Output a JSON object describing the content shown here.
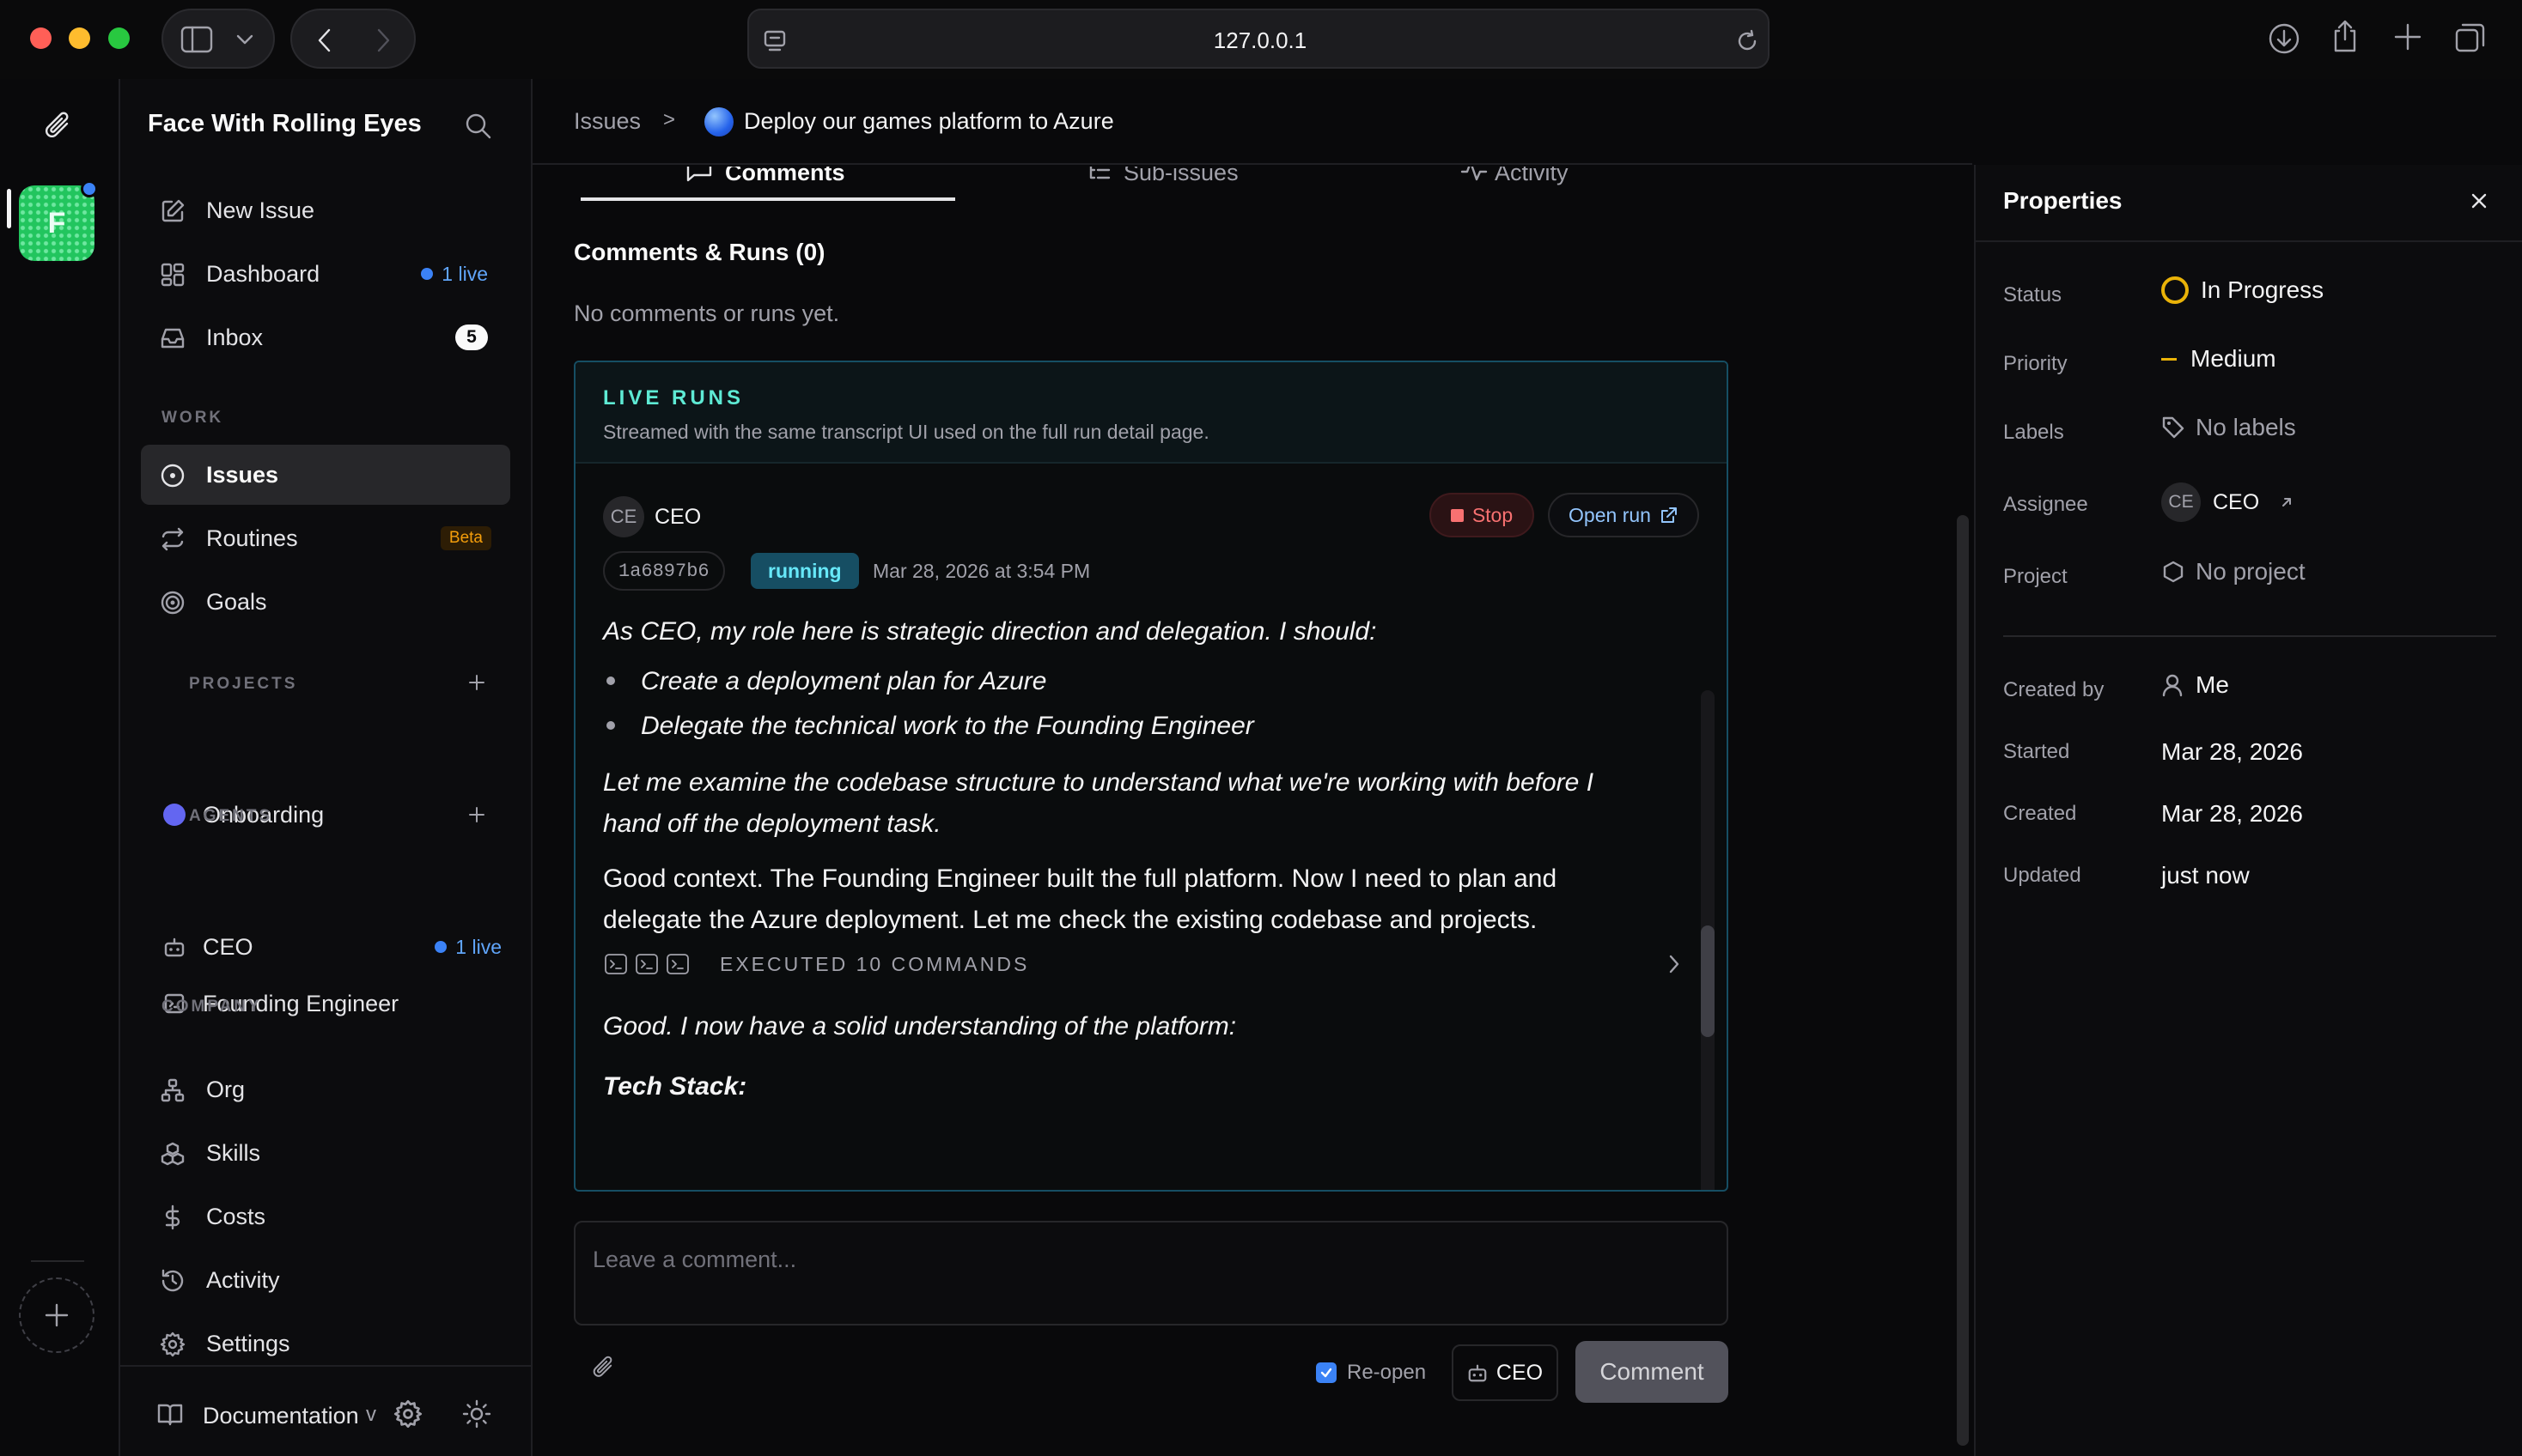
{
  "browser": {
    "url": "127.0.0.1"
  },
  "workspace": {
    "name": "Face With Rolling Eyes",
    "avatar_letter": "F"
  },
  "nav": {
    "new_issue": "New Issue",
    "dashboard": "Dashboard",
    "dashboard_badge": "1 live",
    "inbox": "Inbox",
    "inbox_count": "5",
    "work_header": "WORK",
    "issues": "Issues",
    "routines": "Routines",
    "routines_badge": "Beta",
    "goals": "Goals",
    "projects_header": "PROJECTS",
    "project_onboarding": "Onboarding",
    "agents_header": "AGENTS",
    "agent_ceo": "CEO",
    "agent_ceo_badge": "1 live",
    "agent_founding": "Founding Engineer",
    "company_header": "COMPANY",
    "org": "Org",
    "skills": "Skills",
    "costs": "Costs",
    "activity": "Activity",
    "settings": "Settings",
    "documentation": "Documentation",
    "doc_chevron": "v"
  },
  "breadcrumb": {
    "root": "Issues",
    "separator": ">",
    "current": "Deploy our games platform to Azure"
  },
  "tabs": {
    "comments": "Comments",
    "subissues": "Sub-issues",
    "activity": "Activity"
  },
  "comments": {
    "heading": "Comments & Runs (0)",
    "empty": "No comments or runs yet."
  },
  "live_runs": {
    "title": "LIVE RUNS",
    "subtitle": "Streamed with the same transcript UI used on the full run detail page.",
    "agent_initials": "CE",
    "agent_name": "CEO",
    "stop_label": "Stop",
    "open_run_label": "Open run",
    "run_id": "1a6897b6",
    "status": "running",
    "timestamp": "Mar 28, 2026 at 3:54 PM",
    "transcript": {
      "p1": "As CEO, my role here is strategic direction and delegation. I should:",
      "b1": "Create a deployment plan for Azure",
      "b2": "Delegate the technical work to the Founding Engineer",
      "p2": "Let me examine the codebase structure to understand what we're working with before I hand off the deployment task.",
      "p3": "Good context. The Founding Engineer built the full platform. Now I need to plan and delegate the Azure deployment. Let me check the existing codebase and projects.",
      "executed": "EXECUTED 10 COMMANDS",
      "p4": "Good. I now have a solid understanding of the platform:",
      "p5": "Tech Stack:"
    }
  },
  "composer": {
    "placeholder": "Leave a comment...",
    "reopen_label": "Re-open",
    "assignee": "CEO",
    "submit": "Comment"
  },
  "properties": {
    "title": "Properties",
    "status_label": "Status",
    "status_value": "In Progress",
    "priority_label": "Priority",
    "priority_value": "Medium",
    "labels_label": "Labels",
    "labels_value": "No labels",
    "assignee_label": "Assignee",
    "assignee_initials": "CE",
    "assignee_value": "CEO",
    "project_label": "Project",
    "project_value": "No project",
    "created_by_label": "Created by",
    "created_by_value": "Me",
    "started_label": "Started",
    "started_value": "Mar 28, 2026",
    "created_label": "Created",
    "created_value": "Mar 28, 2026",
    "updated_label": "Updated",
    "updated_value": "just now"
  },
  "colors": {
    "accent": "#3b82f6",
    "status": "#eab308",
    "live_runs": "#5eead4",
    "running_bg": "#164e63",
    "stop": "#f87171",
    "beta": "#f59e0b"
  }
}
